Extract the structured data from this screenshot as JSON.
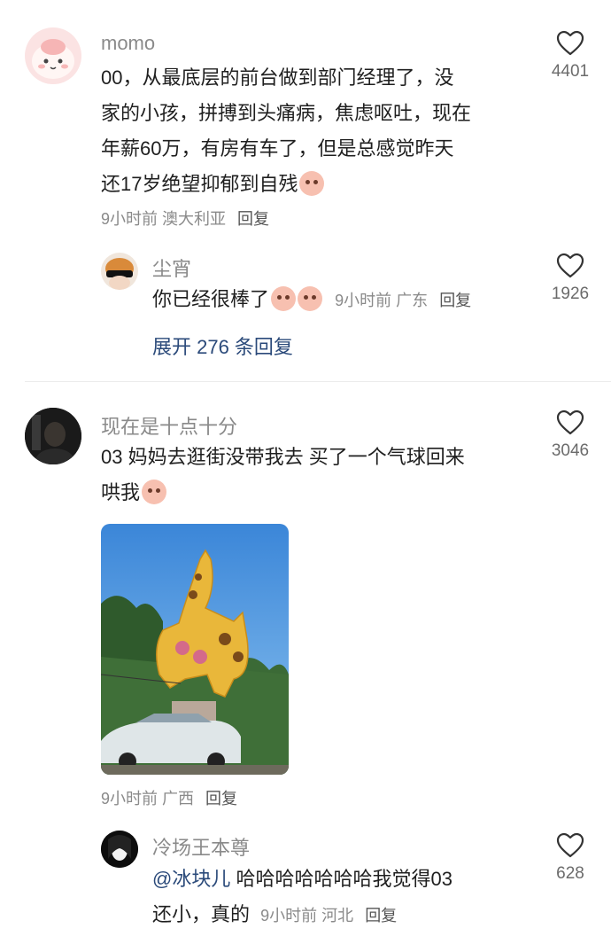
{
  "comments": [
    {
      "name": "momo",
      "lines": [
        "00，从最底层的前台做到部门经理了，没",
        "家的小孩，拼搏到头痛病，焦虑呕吐，现在",
        "年薪60万，有房有车了，但是总感觉昨天",
        "还17岁绝望抑郁到自残"
      ],
      "time": "9小时前",
      "location": "澳大利亚",
      "reply": "回复",
      "likes": "4401"
    },
    {
      "name": "尘宵",
      "text": "你已经很棒了",
      "time": "9小时前",
      "location": "广东",
      "reply": "回复",
      "likes": "1926",
      "expand": "展开 276 条回复"
    },
    {
      "name": "现在是十点十分",
      "lines": [
        "03 妈妈去逛街没带我去 买了一个气球回来",
        "哄我"
      ],
      "time": "9小时前",
      "location": "广西",
      "reply": "回复",
      "likes": "3046"
    },
    {
      "name": "冷场王本尊",
      "mention": "@冰块儿",
      "line1": " 哈哈哈哈哈哈哈我觉得03",
      "line2": "还小，真的",
      "time": "9小时前",
      "location": "河北",
      "reply": "回复",
      "likes": "628"
    }
  ],
  "icons": {
    "like": "heart-outline-icon",
    "emoji": "peach-face-emoji-icon"
  },
  "colors": {
    "link": "#2b4a7a",
    "meta": "#8a8a8a"
  }
}
